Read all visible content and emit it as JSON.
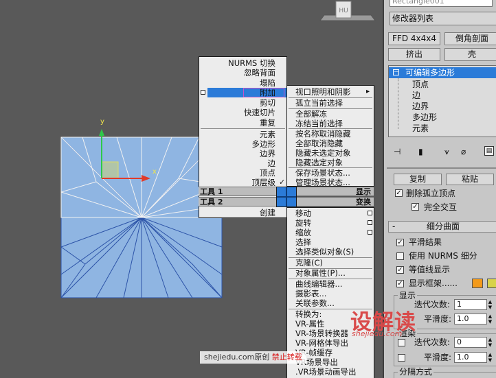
{
  "viewport": {
    "viewcube_label": "",
    "gizmo_y": "y",
    "gizmo_x": "x"
  },
  "quad_menu": {
    "left_items": [
      "NURMS 切换",
      "忽略背面",
      "塌陷",
      "附加",
      "剪切",
      "快速切片",
      "重复",
      "元素",
      "多边形",
      "边界",
      "边",
      "顶点",
      "顶层级",
      "创建"
    ],
    "checked_mark": "✓",
    "tools1": "工具 1",
    "tools2": "工具 2",
    "display": "显示",
    "transform": "变换",
    "right_items": [
      "视口照明和阴影",
      "孤立当前选择",
      "全部解冻",
      "冻结当前选择",
      "按名称取消隐藏",
      "全部取消隐藏",
      "隐藏未选定对象",
      "隐藏选定对象",
      "保存场景状态...",
      "管理场景状态...",
      "移动",
      "旋转",
      "缩放",
      "选择",
      "选择类似对象(S)",
      "克隆(C)",
      "对象属性(P)...",
      "曲线编辑器...",
      "摄影表...",
      "关联参数...",
      "转换为:",
      "VR-属性",
      "VR-场景转换器",
      "VR-网格体导出",
      "VR-帧缓存",
      "VR场景导出",
      ".VR场景动画导出"
    ],
    "submenu_arrow": "▸"
  },
  "panel": {
    "object_name": "Rectangle001",
    "modifier_list": "修改器列表",
    "btn_ffd": "FFD 4x4x4",
    "btn_chamfer": "倒角剖面",
    "btn_extrude": "挤出",
    "btn_shell": "壳",
    "stack_title": "可编辑多边形",
    "stack_items": [
      "顶点",
      "边",
      "边界",
      "多边形",
      "元素"
    ],
    "copy": "复制",
    "paste": "粘贴",
    "delete_isolated": "删除孤立顶点",
    "full_interactive": "完全交互",
    "subdivision_header": "细分曲面",
    "smooth_result": "平滑结果",
    "use_nurms": "使用 NURMS 细分",
    "isoline": "等值线显示",
    "show_cage": "显示框架......",
    "display_group": "显示",
    "iterations_label": "迭代次数:",
    "iterations_value": "1",
    "smoothness_label": "平滑度:",
    "smoothness_value": "1.0",
    "render_group": "渲染",
    "render_iterations_value": "0",
    "render_smoothness_value": "1.0",
    "separate_by": "分隔方式",
    "cage_color1": "#f39a1a",
    "cage_color2": "#d8d24a"
  },
  "watermark": {
    "left": "shejiedu.com原创",
    "red": "禁止转载",
    "logo": "设解读",
    "url": "shejiedu.com"
  }
}
